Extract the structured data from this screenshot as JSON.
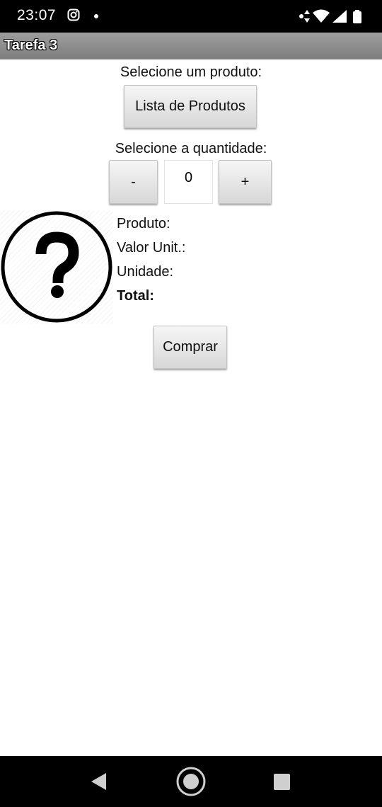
{
  "status_bar": {
    "time": "23:07",
    "icons": [
      "instagram-icon",
      "notification-dot",
      "data-arrows-icon",
      "wifi-icon",
      "signal-icon",
      "battery-icon"
    ]
  },
  "app": {
    "title": "Tarefa 3"
  },
  "product_section": {
    "prompt": "Selecione um produto:",
    "list_button": "Lista de Produtos"
  },
  "quantity_section": {
    "prompt": "Selecione a quantidade:",
    "minus": "-",
    "value": "0",
    "plus": "+"
  },
  "details": {
    "image_icon": "question-mark-icon",
    "product_label": "Produto:",
    "unit_price_label": "Valor Unit.:",
    "unit_label": "Unidade:",
    "total_label": "Total:"
  },
  "actions": {
    "buy_button": "Comprar"
  },
  "nav_bar": {
    "icons": [
      "back-icon",
      "home-icon",
      "recents-icon"
    ]
  }
}
